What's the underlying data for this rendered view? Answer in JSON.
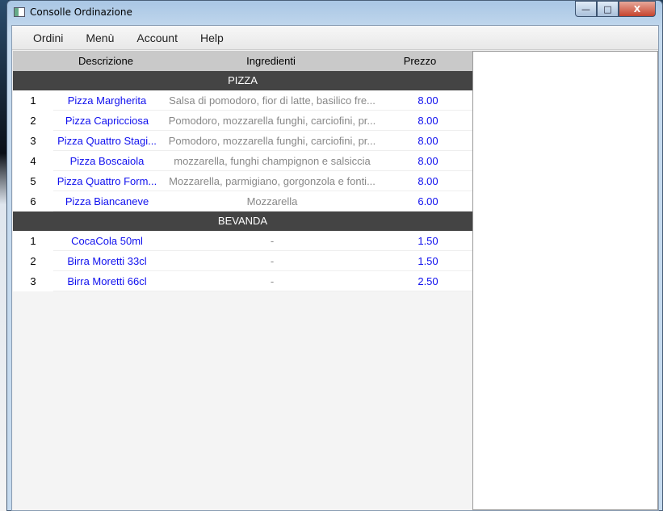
{
  "window": {
    "title": "Consolle Ordinazione",
    "minimize": "—",
    "maximize": "□",
    "close": "X"
  },
  "menu": [
    "Ordini",
    "Menù",
    "Account",
    "Help"
  ],
  "table": {
    "headers": {
      "description": "Descrizione",
      "ingredients": "Ingredienti",
      "price": "Prezzo"
    },
    "groups": [
      {
        "name": "PIZZA",
        "items": [
          {
            "n": "1",
            "name": "Pizza Margherita",
            "ingredients": "Salsa di pomodoro, fior di latte, basilico fre...",
            "price": "8.00"
          },
          {
            "n": "2",
            "name": "Pizza Capricciosa",
            "ingredients": "Pomodoro, mozzarella funghi, carciofini, pr...",
            "price": "8.00"
          },
          {
            "n": "3",
            "name": "Pizza Quattro Stagi...",
            "ingredients": "Pomodoro, mozzarella funghi, carciofini, pr...",
            "price": "8.00"
          },
          {
            "n": "4",
            "name": "Pizza Boscaiola",
            "ingredients": "mozzarella, funghi champignon e salsiccia",
            "price": "8.00"
          },
          {
            "n": "5",
            "name": "Pizza Quattro Form...",
            "ingredients": "Mozzarella, parmigiano, gorgonzola e fonti...",
            "price": "8.00"
          },
          {
            "n": "6",
            "name": "Pizza Biancaneve",
            "ingredients": "Mozzarella",
            "price": "6.00"
          }
        ]
      },
      {
        "name": "BEVANDA",
        "items": [
          {
            "n": "1",
            "name": "CocaCola 50ml",
            "ingredients": "-",
            "price": "1.50"
          },
          {
            "n": "2",
            "name": "Birra Moretti 33cl",
            "ingredients": "-",
            "price": "1.50"
          },
          {
            "n": "3",
            "name": "Birra Moretti 66cl",
            "ingredients": "-",
            "price": "2.50"
          }
        ]
      }
    ]
  }
}
